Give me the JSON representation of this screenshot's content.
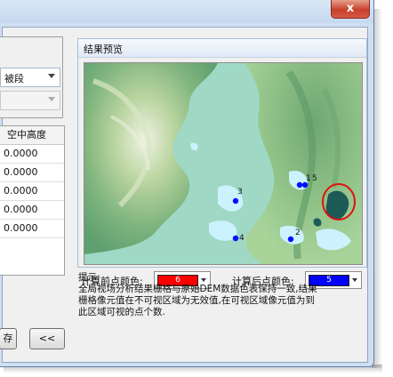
{
  "window": {
    "close_label": "x"
  },
  "left_panel": {
    "combo1_value": "被段",
    "table": {
      "column_header": "空中高度",
      "rows": [
        "0.0000",
        "0.0000",
        "0.0000",
        "0.0000",
        "0.0000"
      ]
    },
    "save_button_label": "存",
    "back_button_label": "<<"
  },
  "preview": {
    "title": "结果预览",
    "map_labels": [
      "1",
      "5",
      "3",
      "4",
      "2"
    ]
  },
  "colors": {
    "before_label": "计算前点颜色:",
    "before_value": "6",
    "before_hex": "#ff0000",
    "after_label": "计算后点颜色:",
    "after_value": "5",
    "after_hex": "#0000ff"
  },
  "tips": {
    "title": "提示:",
    "line1": "全局视场分析结果栅格与原始DEM数据色表保持一致,结果",
    "line2": "栅格像元值在不可视区域为无效值,在可视区域像元值为到",
    "line3": "此区域可视的点个数."
  }
}
